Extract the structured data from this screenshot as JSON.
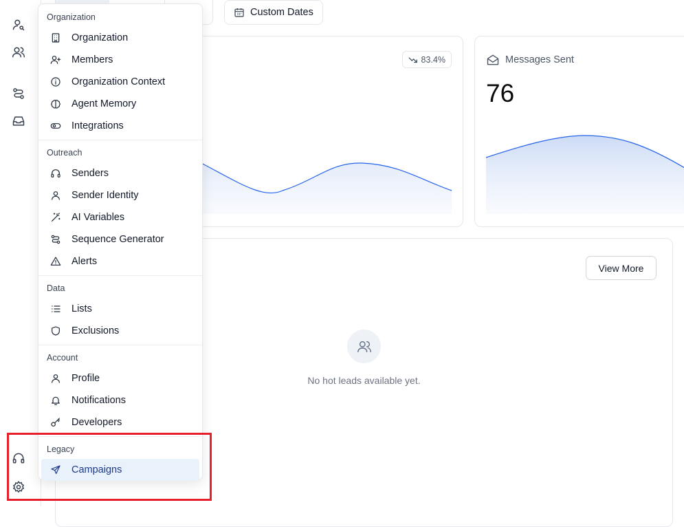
{
  "filters": {
    "custom_dates_label": "Custom Dates"
  },
  "stats": {
    "card1": {
      "trend": "83.4%"
    },
    "card2": {
      "title": "Messages Sent",
      "value": "76"
    }
  },
  "hot_leads": {
    "view_more_label": "View More",
    "empty_text": "No hot leads available yet."
  },
  "menu": {
    "sections": [
      {
        "title": "Organization",
        "items": [
          {
            "label": "Organization",
            "icon": "building-icon"
          },
          {
            "label": "Members",
            "icon": "user-plus-icon"
          },
          {
            "label": "Organization Context",
            "icon": "info-icon"
          },
          {
            "label": "Agent Memory",
            "icon": "brain-icon"
          },
          {
            "label": "Integrations",
            "icon": "toggle-icon"
          }
        ]
      },
      {
        "title": "Outreach",
        "items": [
          {
            "label": "Senders",
            "icon": "headphones-icon"
          },
          {
            "label": "Sender Identity",
            "icon": "user-icon"
          },
          {
            "label": "AI Variables",
            "icon": "magic-wand-icon"
          },
          {
            "label": "Sequence Generator",
            "icon": "route-icon"
          },
          {
            "label": "Alerts",
            "icon": "warning-icon"
          }
        ]
      },
      {
        "title": "Data",
        "items": [
          {
            "label": "Lists",
            "icon": "list-icon"
          },
          {
            "label": "Exclusions",
            "icon": "shield-icon"
          }
        ]
      },
      {
        "title": "Account",
        "items": [
          {
            "label": "Profile",
            "icon": "user-icon"
          },
          {
            "label": "Notifications",
            "icon": "bell-icon"
          },
          {
            "label": "Developers",
            "icon": "key-icon"
          }
        ]
      },
      {
        "title": "Legacy",
        "items": [
          {
            "label": "Campaigns",
            "icon": "send-icon",
            "selected": true
          }
        ]
      }
    ]
  },
  "colors": {
    "accent": "#2563eb",
    "highlight": "#e5202b",
    "selected_bg": "#e9f1fb"
  }
}
